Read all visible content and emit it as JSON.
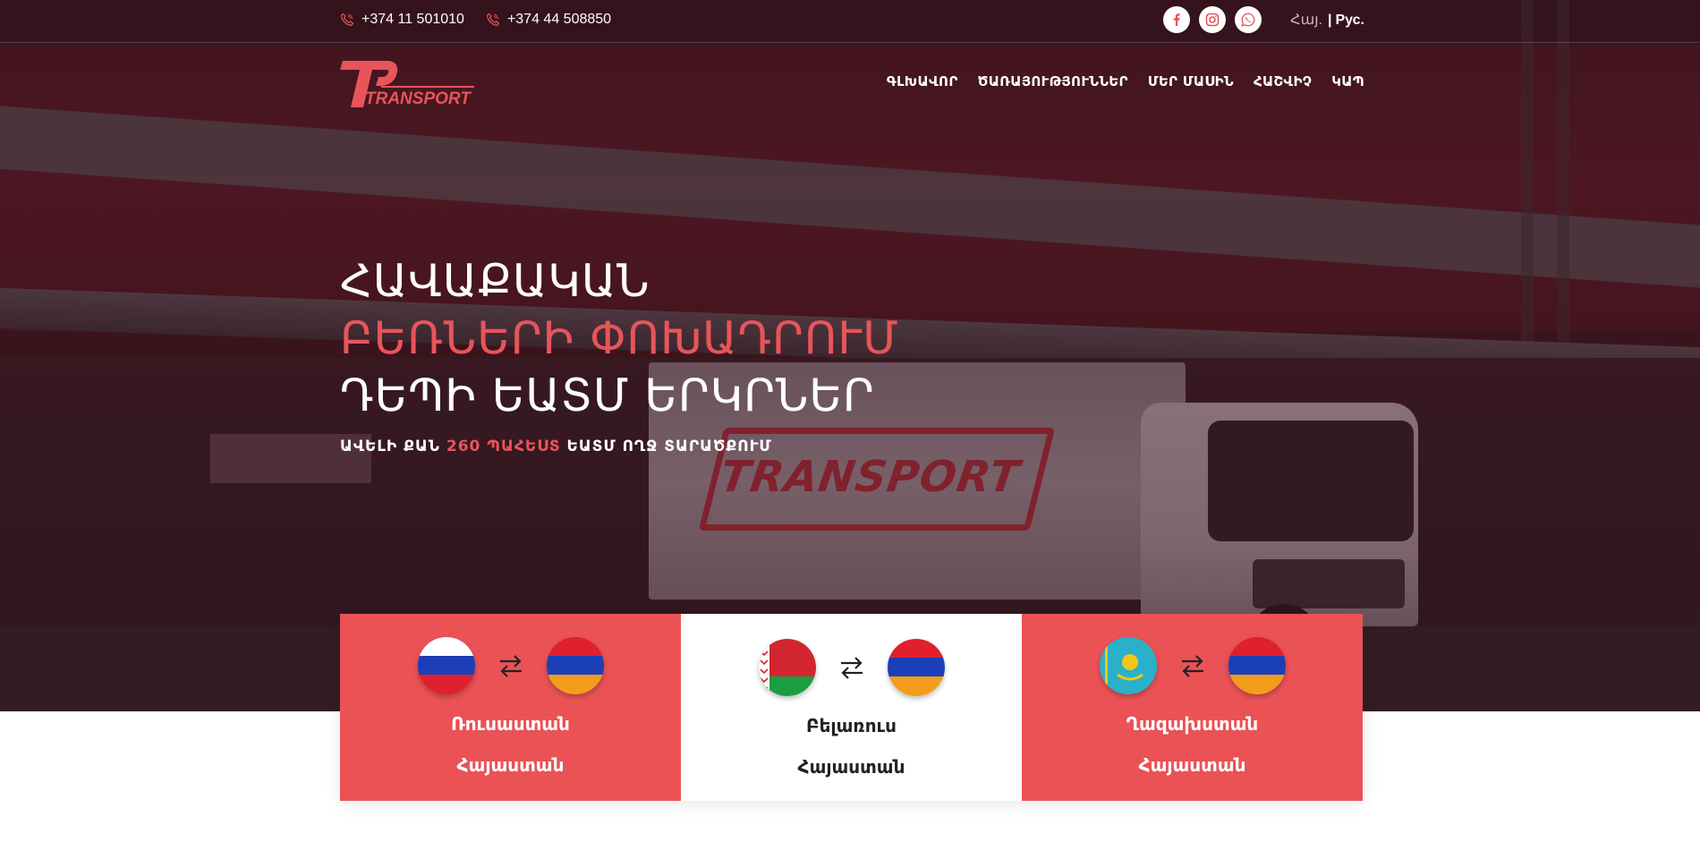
{
  "topbar": {
    "phones": [
      "+374 11 501010",
      "+374 44 508850"
    ],
    "social_icons": [
      "facebook-icon",
      "instagram-icon",
      "whatsapp-icon"
    ],
    "lang_hy": "Հայ.",
    "lang_sep": "|",
    "lang_ru": "Рус."
  },
  "logo": {
    "text": "TRANSPORT",
    "monogram": "TP"
  },
  "nav": {
    "items": [
      "ԳԼԽԱՎՈՐ",
      "ԾԱՌԱՅՈՒԹՅՈՒՆՆԵՐ",
      "ՄԵՐ ՄԱՍԻՆ",
      "ՀԱՇՎԻՉ",
      "ԿԱՊ"
    ]
  },
  "hero": {
    "line1": "ՀԱՎԱՔԱԿԱՆ",
    "line2": "ԲԵՌՆԵՐԻ ՓՈԽԱԴՐՈՒՄ",
    "line3": "ԴԵՊԻ ԵԱՏՄ ԵՐԿՐՆԵՐ",
    "sub_prefix": "ԱՎԵԼԻ ՔԱՆ",
    "sub_accent": "260 ՊԱՀԵՍՏ",
    "sub_suffix": "ԵԱՏՄ ՈՂՋ ՏԱՐԱԾՔՈՒՄ",
    "trailer_text": "TRANSPORT"
  },
  "routes": [
    {
      "from": "Ռուսաստան",
      "to": "Հայաստան",
      "from_flag": "russia-flag-icon",
      "to_flag": "armenia-flag-icon"
    },
    {
      "from": "Բելառուս",
      "to": "Հայաստան",
      "from_flag": "belarus-flag-icon",
      "to_flag": "armenia-flag-icon"
    },
    {
      "from": "Ղազախստան",
      "to": "Հայաստան",
      "from_flag": "kazakhstan-flag-icon",
      "to_flag": "armenia-flag-icon"
    }
  ],
  "colors": {
    "accent": "#ea5256",
    "hero_overlay": "#3c0e18",
    "text_light": "#ffffff"
  }
}
